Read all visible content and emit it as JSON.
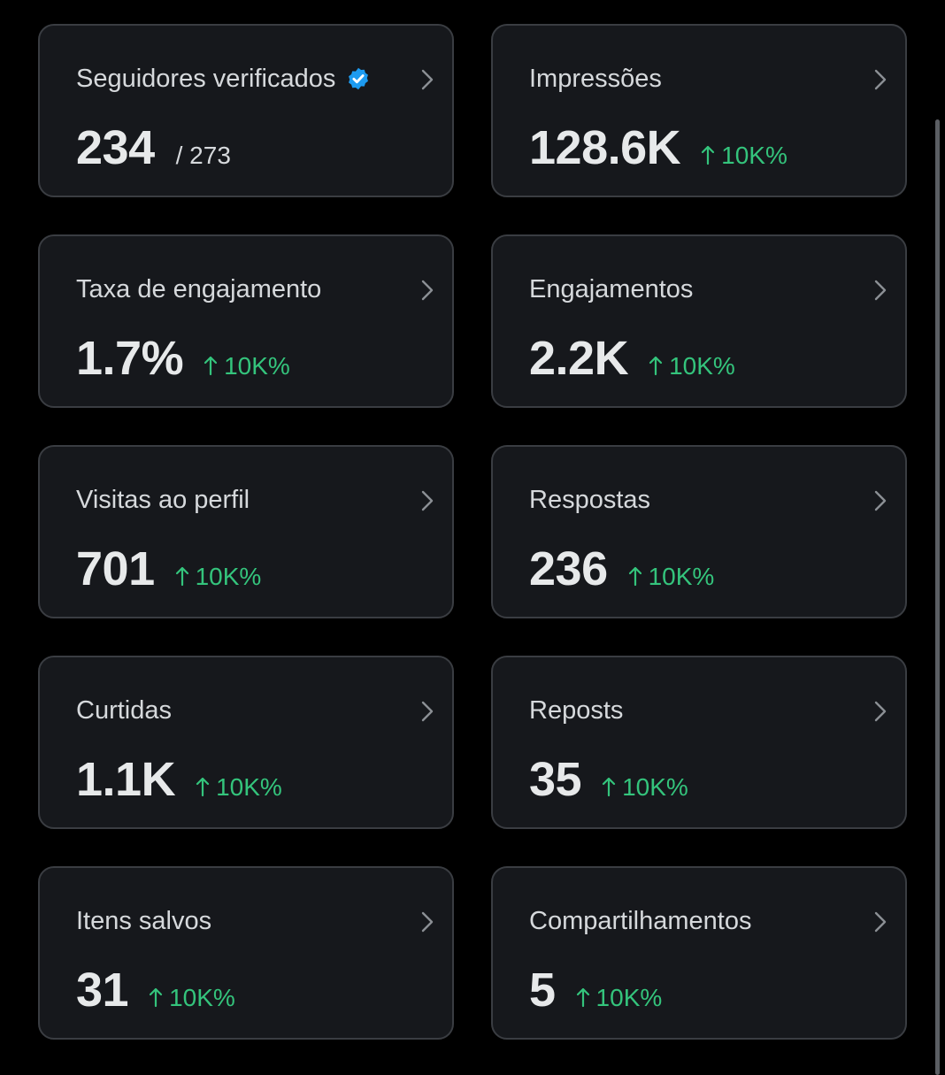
{
  "colors": {
    "background": "#000000",
    "card_bg": "#16181c",
    "card_border": "#3a3d42",
    "positive": "#34c47c",
    "verified_badge": "#1d9bf0",
    "text_primary": "#e7e9ea",
    "text_secondary": "#d6d9dc"
  },
  "cards": [
    {
      "title": "Seguidores verificados",
      "value": "234",
      "sub": "/ 273",
      "change": "",
      "verified_icon": "verified-badge-icon"
    },
    {
      "title": "Impressões",
      "value": "128.6K",
      "sub": "",
      "change": "10K%"
    },
    {
      "title": "Taxa de engajamento",
      "value": "1.7%",
      "sub": "",
      "change": "10K%"
    },
    {
      "title": "Engajamentos",
      "value": "2.2K",
      "sub": "",
      "change": "10K%"
    },
    {
      "title": "Visitas ao perfil",
      "value": "701",
      "sub": "",
      "change": "10K%"
    },
    {
      "title": "Respostas",
      "value": "236",
      "sub": "",
      "change": "10K%"
    },
    {
      "title": "Curtidas",
      "value": "1.1K",
      "sub": "",
      "change": "10K%"
    },
    {
      "title": "Reposts",
      "value": "35",
      "sub": "",
      "change": "10K%"
    },
    {
      "title": "Itens salvos",
      "value": "31",
      "sub": "",
      "change": "10K%"
    },
    {
      "title": "Compartilhamentos",
      "value": "5",
      "sub": "",
      "change": "10K%"
    }
  ]
}
